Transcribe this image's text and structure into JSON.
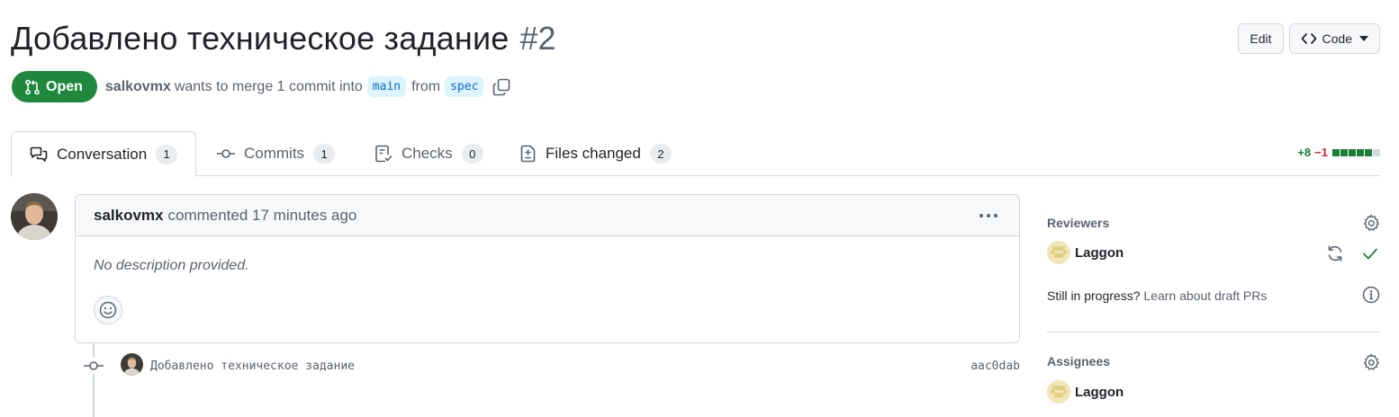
{
  "pr": {
    "title": "Добавлено техническое задание",
    "number": "#2",
    "state": "Open",
    "author": "salkovmx",
    "merge_text": "wants to merge 1 commit into",
    "base_branch": "main",
    "from_text": "from",
    "head_branch": "spec"
  },
  "header": {
    "edit_label": "Edit",
    "code_label": "Code"
  },
  "tabs": [
    {
      "label": "Conversation",
      "count": "1"
    },
    {
      "label": "Commits",
      "count": "1"
    },
    {
      "label": "Checks",
      "count": "0"
    },
    {
      "label": "Files changed",
      "count": "2"
    }
  ],
  "diffstat": {
    "additions": "+8",
    "deletions": "−1",
    "colors": {
      "add": "#1a7f37",
      "del": "#d1242f",
      "neutral": "#d1d9e0"
    }
  },
  "comment": {
    "author": "salkovmx",
    "action": "commented 17 minutes ago",
    "body": "No description provided."
  },
  "commit": {
    "message": "Добавлено техническое задание",
    "sha": "aac0dab"
  },
  "sidebar": {
    "reviewers_heading": "Reviewers",
    "reviewer": "Laggon",
    "draft_question": "Still in progress?",
    "draft_link": "Learn about draft PRs",
    "assignees_heading": "Assignees",
    "assignee": "Laggon"
  },
  "colors": {
    "open_green": "#1f883d",
    "branch_bg": "#ddf4ff",
    "branch_fg": "#0969da",
    "approved_check": "#1a7f37"
  }
}
